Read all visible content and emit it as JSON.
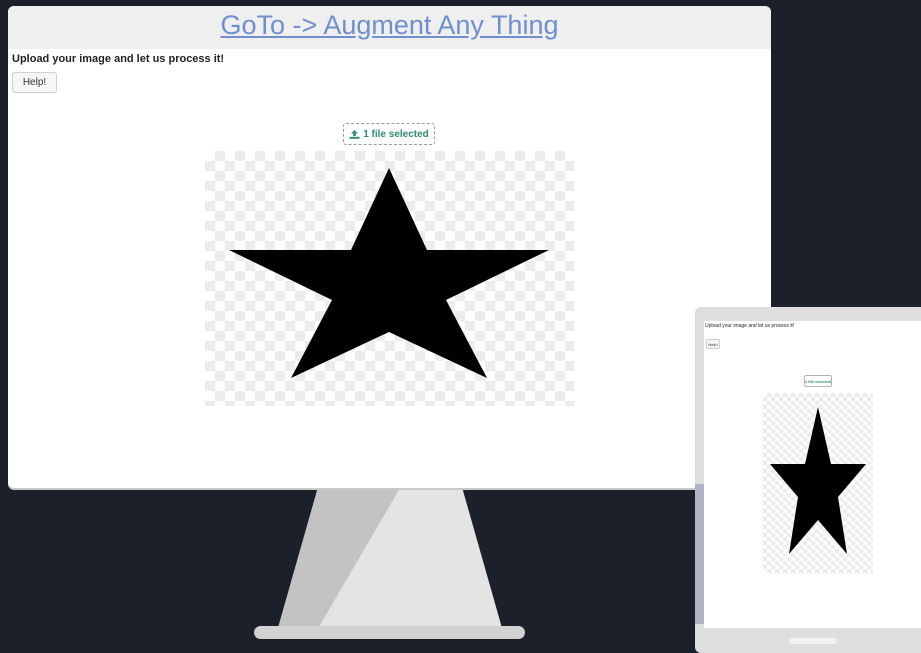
{
  "desktop": {
    "link_text": "GoTo -> Augment Any Thing",
    "heading": "Upload your image and let us process it!",
    "help_label": "Help!",
    "file_status": "1 file selected"
  },
  "mobile": {
    "heading": "Upload your image and let us process it!",
    "help_label": "Help!",
    "file_status": "1 file selected"
  },
  "colors": {
    "background": "#1b202a",
    "link": "#6f8fcf",
    "accent_green": "#2f8d6b"
  },
  "icons": {
    "upload": "upload-icon",
    "star": "star-image"
  }
}
